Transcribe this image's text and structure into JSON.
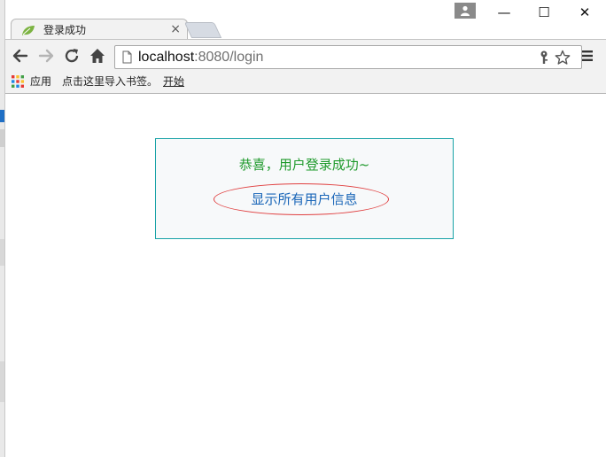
{
  "browser": {
    "tab_title": "登录成功",
    "tab_close": "×",
    "window_controls": {
      "minimize": "—",
      "maximize": "☐",
      "close": "✕"
    },
    "url_host": "localhost",
    "url_rest": ":8080/login",
    "icons": [
      "back-icon",
      "forward-icon",
      "reload-icon",
      "home-icon",
      "page-icon",
      "key-icon",
      "star-icon",
      "menu-icon",
      "apps-icon",
      "profile-icon",
      "spring-leaf-icon"
    ]
  },
  "bookmarks": {
    "apps_label": "应用",
    "import_text": "点击这里导入书签。",
    "start_label": "开始"
  },
  "page": {
    "success_message": "恭喜，用户登录成功~",
    "show_all_link": "显示所有用户信息"
  },
  "colors": {
    "panel_border": "#17a2a6",
    "success_text": "#1f9a2c",
    "link_text": "#1a66b8",
    "annotation_ellipse": "#e04040"
  }
}
